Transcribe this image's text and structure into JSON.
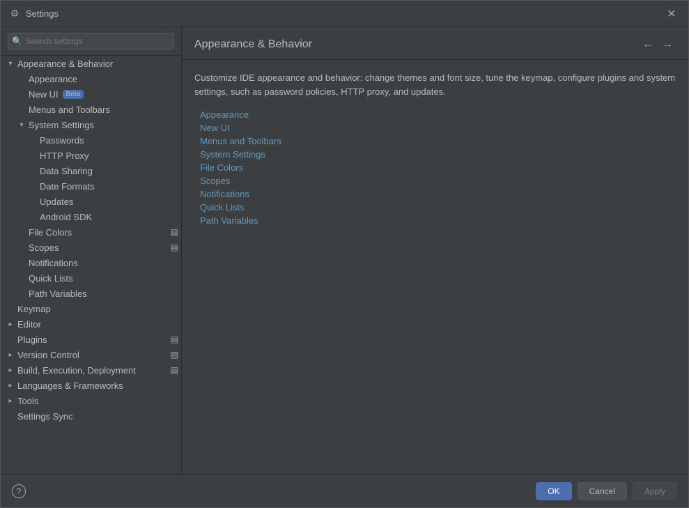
{
  "window": {
    "title": "Settings",
    "close_label": "✕"
  },
  "search": {
    "placeholder": "🔍",
    "value": ""
  },
  "sidebar": {
    "items": [
      {
        "id": "appearance-behavior",
        "label": "Appearance & Behavior",
        "level": "level0",
        "expanded": true,
        "selected": false,
        "has_expand": true,
        "expand_icon": "▾",
        "children": [
          {
            "id": "appearance",
            "label": "Appearance",
            "level": "level1",
            "selected": false,
            "has_expand": false
          },
          {
            "id": "new-ui",
            "label": "New UI",
            "level": "level1",
            "selected": false,
            "has_expand": false,
            "badge": "Beta"
          },
          {
            "id": "menus-toolbars",
            "label": "Menus and Toolbars",
            "level": "level1",
            "selected": false,
            "has_expand": false
          },
          {
            "id": "system-settings",
            "label": "System Settings",
            "level": "level1",
            "expanded": true,
            "selected": false,
            "has_expand": true,
            "expand_icon": "▾",
            "children": [
              {
                "id": "passwords",
                "label": "Passwords",
                "level": "level2",
                "selected": false
              },
              {
                "id": "http-proxy",
                "label": "HTTP Proxy",
                "level": "level2",
                "selected": false
              },
              {
                "id": "data-sharing",
                "label": "Data Sharing",
                "level": "level2",
                "selected": false
              },
              {
                "id": "date-formats",
                "label": "Date Formats",
                "level": "level2",
                "selected": false
              },
              {
                "id": "updates",
                "label": "Updates",
                "level": "level2",
                "selected": false
              },
              {
                "id": "android-sdk",
                "label": "Android SDK",
                "level": "level2",
                "selected": false
              }
            ]
          },
          {
            "id": "file-colors",
            "label": "File Colors",
            "level": "level1",
            "selected": false,
            "has_indicator": true
          },
          {
            "id": "scopes",
            "label": "Scopes",
            "level": "level1",
            "selected": false,
            "has_indicator": true
          },
          {
            "id": "notifications",
            "label": "Notifications",
            "level": "level1",
            "selected": false
          },
          {
            "id": "quick-lists",
            "label": "Quick Lists",
            "level": "level1",
            "selected": false
          },
          {
            "id": "path-variables",
            "label": "Path Variables",
            "level": "level1",
            "selected": false
          }
        ]
      },
      {
        "id": "keymap",
        "label": "Keymap",
        "level": "level0",
        "selected": false,
        "has_expand": false
      },
      {
        "id": "editor",
        "label": "Editor",
        "level": "level0",
        "selected": false,
        "has_expand": true,
        "expand_icon": "▸"
      },
      {
        "id": "plugins",
        "label": "Plugins",
        "level": "level0",
        "selected": false,
        "has_expand": false,
        "has_indicator": true
      },
      {
        "id": "version-control",
        "label": "Version Control",
        "level": "level0",
        "selected": false,
        "has_expand": true,
        "expand_icon": "▸",
        "has_indicator": true
      },
      {
        "id": "build-execution",
        "label": "Build, Execution, Deployment",
        "level": "level0",
        "selected": false,
        "has_expand": true,
        "expand_icon": "▸",
        "has_indicator": true
      },
      {
        "id": "languages",
        "label": "Languages & Frameworks",
        "level": "level0",
        "selected": false,
        "has_expand": true,
        "expand_icon": "▸"
      },
      {
        "id": "tools",
        "label": "Tools",
        "level": "level0",
        "selected": false,
        "has_expand": true,
        "expand_icon": "▸"
      },
      {
        "id": "settings-sync",
        "label": "Settings Sync",
        "level": "level0",
        "selected": false,
        "has_expand": false
      }
    ]
  },
  "main": {
    "title": "Appearance & Behavior",
    "description": "Customize IDE appearance and behavior: change themes and font size, tune the keymap, configure plugins and system settings, such as password policies, HTTP proxy, and updates.",
    "links": [
      "Appearance",
      "New UI",
      "Menus and Toolbars",
      "System Settings",
      "File Colors",
      "Scopes",
      "Notifications",
      "Quick Lists",
      "Path Variables"
    ]
  },
  "footer": {
    "help_label": "?",
    "ok_label": "OK",
    "cancel_label": "Cancel",
    "apply_label": "Apply"
  }
}
